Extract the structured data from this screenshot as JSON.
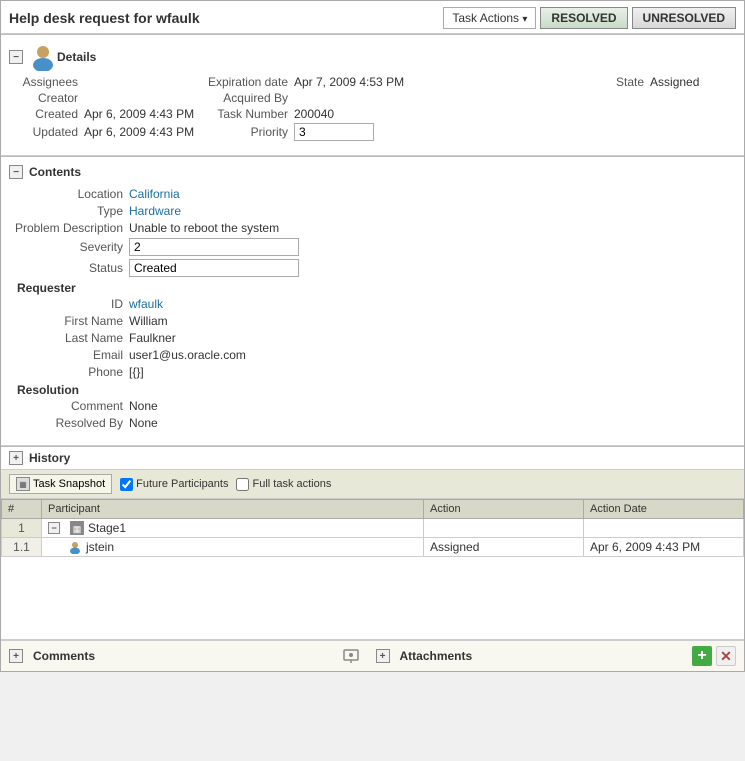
{
  "header": {
    "title": "Help desk request for wfaulk",
    "task_actions_label": "Task Actions",
    "btn_resolved": "RESOLVED",
    "btn_unresolved": "UNRESOLVED"
  },
  "details_section": {
    "toggle": "−",
    "label": "Details",
    "fields": {
      "assignees_label": "Assignees",
      "creator_label": "Creator",
      "created_label": "Created",
      "updated_label": "Updated",
      "expiration_date_label": "Expiration date",
      "expiration_date_value": "Apr 7, 2009 4:53 PM",
      "acquired_by_label": "Acquired By",
      "task_number_label": "Task Number",
      "task_number_value": "200040",
      "priority_label": "Priority",
      "priority_value": "3",
      "state_label": "State",
      "state_value": "Assigned",
      "created_value": "Apr 6, 2009 4:43 PM",
      "updated_value": "Apr 6, 2009 4:43 PM"
    }
  },
  "contents_section": {
    "toggle": "−",
    "label": "Contents",
    "fields": {
      "location_label": "Location",
      "location_value": "California",
      "type_label": "Type",
      "type_value": "Hardware",
      "problem_description_label": "Problem Description",
      "problem_description_value": "Unable to reboot the system",
      "severity_label": "Severity",
      "severity_value": "2",
      "status_label": "Status",
      "status_value": "Created"
    },
    "requester": {
      "label": "Requester",
      "id_label": "ID",
      "id_value": "wfaulk",
      "first_name_label": "First Name",
      "first_name_value": "William",
      "last_name_label": "Last Name",
      "last_name_value": "Faulkner",
      "email_label": "Email",
      "email_value": "user1@us.oracle.com",
      "phone_label": "Phone",
      "phone_value": "[{}]"
    },
    "resolution": {
      "label": "Resolution",
      "comment_label": "Comment",
      "comment_value": "None",
      "resolved_by_label": "Resolved By",
      "resolved_by_value": "None"
    }
  },
  "history_section": {
    "toggle": "+",
    "label": "History",
    "toolbar": {
      "snapshot_btn": "Task Snapshot",
      "future_participants_label": "Future Participants",
      "full_task_actions_label": "Full task actions",
      "future_checked": true,
      "full_checked": false
    },
    "table": {
      "col_number": "#",
      "col_participant": "Participant",
      "col_action": "Action",
      "col_action_date": "Action Date",
      "rows": [
        {
          "number": "1",
          "participant": "Stage1",
          "action": "",
          "action_date": "",
          "type": "stage",
          "sub_rows": [
            {
              "number": "1.1",
              "participant": "jstein",
              "action": "Assigned",
              "action_date": "Apr 6, 2009 4:43 PM",
              "type": "user"
            }
          ]
        }
      ]
    }
  },
  "footer": {
    "comments_label": "Comments",
    "attachments_label": "Attachments",
    "comments_icon": "comment-icon",
    "attachments_icon": "attachment-icon"
  }
}
